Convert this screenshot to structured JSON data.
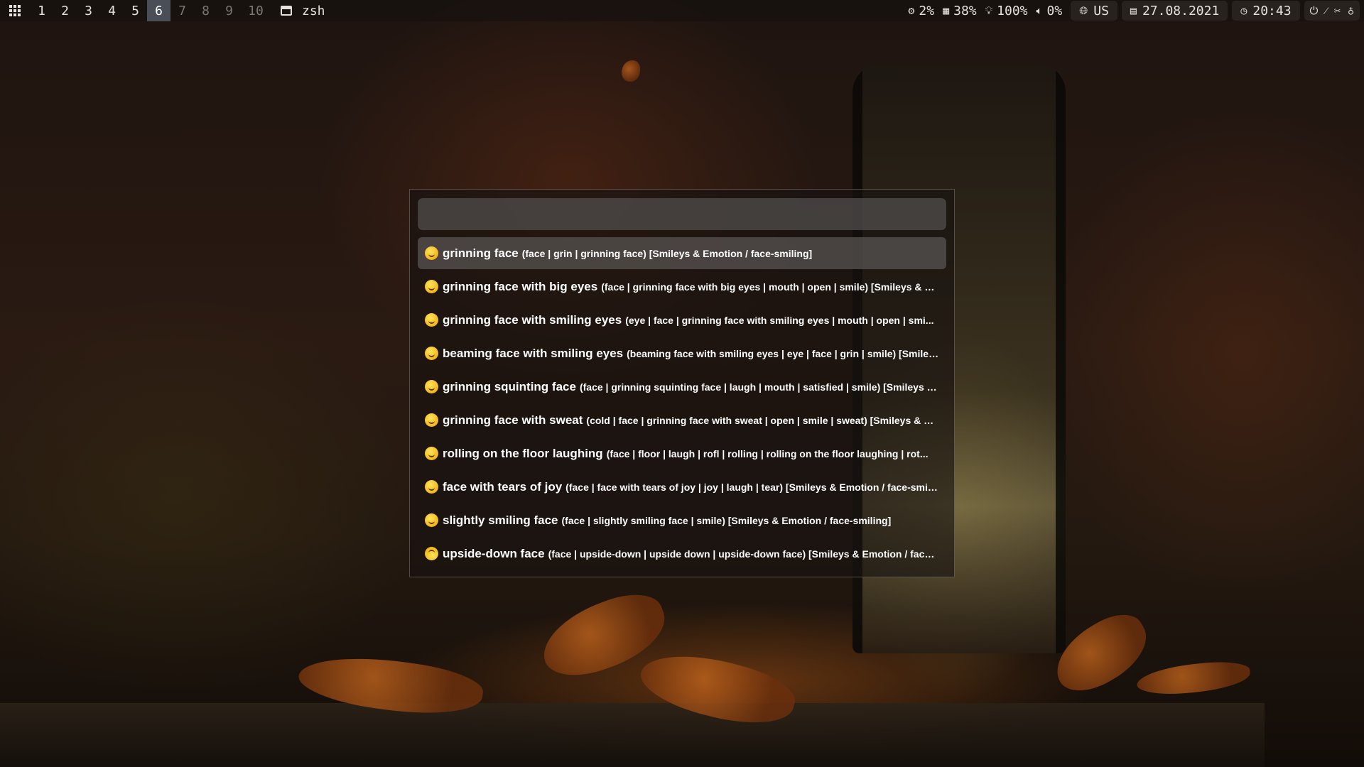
{
  "topbar": {
    "workspaces": [
      "1",
      "2",
      "3",
      "4",
      "5",
      "6",
      "7",
      "8",
      "9",
      "10"
    ],
    "active_workspace": "6",
    "window_title": "zsh",
    "cpu": "2%",
    "memory": "38%",
    "brightness": "100%",
    "volume": "0%",
    "keyboard_layout": "US",
    "date": "27.08.2021",
    "time": "20:43"
  },
  "picker": {
    "search_value": "",
    "items": [
      {
        "name": "grinning face",
        "tags": "(face | grin | grinning face) [Smileys & Emotion / face-smiling]",
        "selected": true
      },
      {
        "name": "grinning face with big eyes",
        "tags": "(face | grinning face with big eyes | mouth | open | smile) [Smileys & Emo...",
        "selected": false
      },
      {
        "name": "grinning face with smiling eyes",
        "tags": "(eye | face | grinning face with smiling eyes | mouth | open | smi...",
        "selected": false
      },
      {
        "name": "beaming face with smiling eyes",
        "tags": "(beaming face with smiling eyes | eye | face | grin | smile) [Smileys...",
        "selected": false
      },
      {
        "name": "grinning squinting face",
        "tags": "(face | grinning squinting face | laugh | mouth | satisfied | smile) [Smileys & ...",
        "selected": false
      },
      {
        "name": "grinning face with sweat",
        "tags": "(cold | face | grinning face with sweat | open | smile | sweat) [Smileys & Em...",
        "selected": false
      },
      {
        "name": "rolling on the floor laughing",
        "tags": "(face | floor | laugh | rofl | rolling | rolling on the floor laughing | rot...",
        "selected": false
      },
      {
        "name": "face with tears of joy",
        "tags": "(face | face with tears of joy | joy | laugh | tear) [Smileys & Emotion / face-smiling]",
        "selected": false
      },
      {
        "name": "slightly smiling face",
        "tags": "(face | slightly smiling face | smile) [Smileys & Emotion / face-smiling]",
        "selected": false
      },
      {
        "name": "upside-down face",
        "tags": "(face | upside-down | upside down | upside-down face) [Smileys & Emotion / face-smiling]",
        "selected": false
      }
    ]
  }
}
